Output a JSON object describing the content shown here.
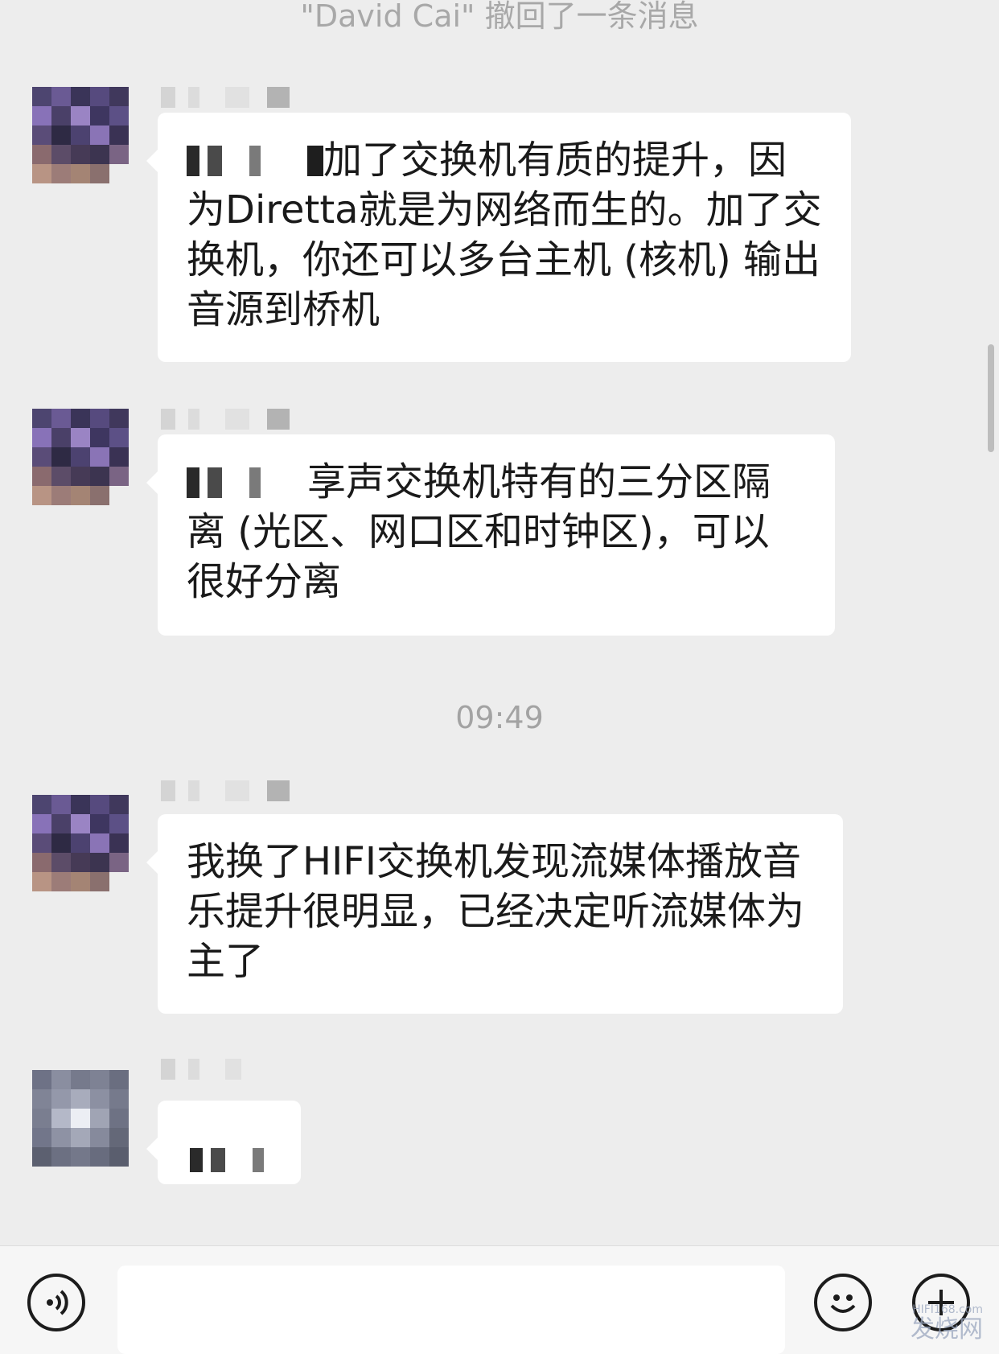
{
  "system": {
    "recall_notice": "\"David Cai\" 撤回了一条消息",
    "time": "09:49"
  },
  "messages": [
    {
      "text": "加了交换机有质的提升，因为Diretta就是为网络而生的。加了交换机，你还可以多台主机 (核机) 输出音源到桥机"
    },
    {
      "text": "享声交换机特有的三分区隔离 (光区、网口区和时钟区)，可以很好分离"
    },
    {
      "text": "我换了HIFI交换机发现流媒体播放音乐提升很明显，已经决定听流媒体为主了"
    }
  ],
  "input_bar": {
    "voice_icon": "voice-icon",
    "emoji_icon": "emoji-icon",
    "add_icon": "plus-icon",
    "input_value": ""
  },
  "watermark": {
    "site": "HIFI168.com",
    "brand": "发烧网"
  }
}
